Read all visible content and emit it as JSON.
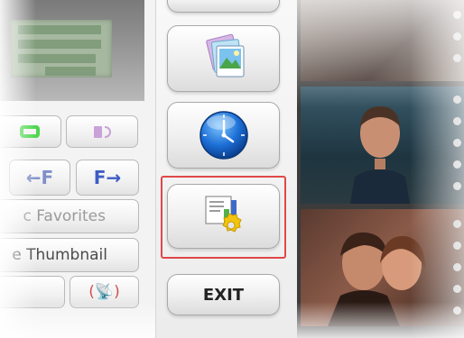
{
  "left_panel": {
    "rewind_label": "←F",
    "forward_label": "F→",
    "favorites_label": "c Favorites",
    "thumbnail_label": "e Thumbnail"
  },
  "middle_panel": {
    "exit_label": "EXIT",
    "selected_button": "settings"
  },
  "colors": {
    "accent_blue": "#3d5cc4",
    "selection_red": "#e04848",
    "repeat_green": "#4ed64e"
  },
  "icons": [
    "photo-icon",
    "clock-icon",
    "settings-icon",
    "repeat-icon",
    "volume-icon",
    "radio-icon"
  ]
}
